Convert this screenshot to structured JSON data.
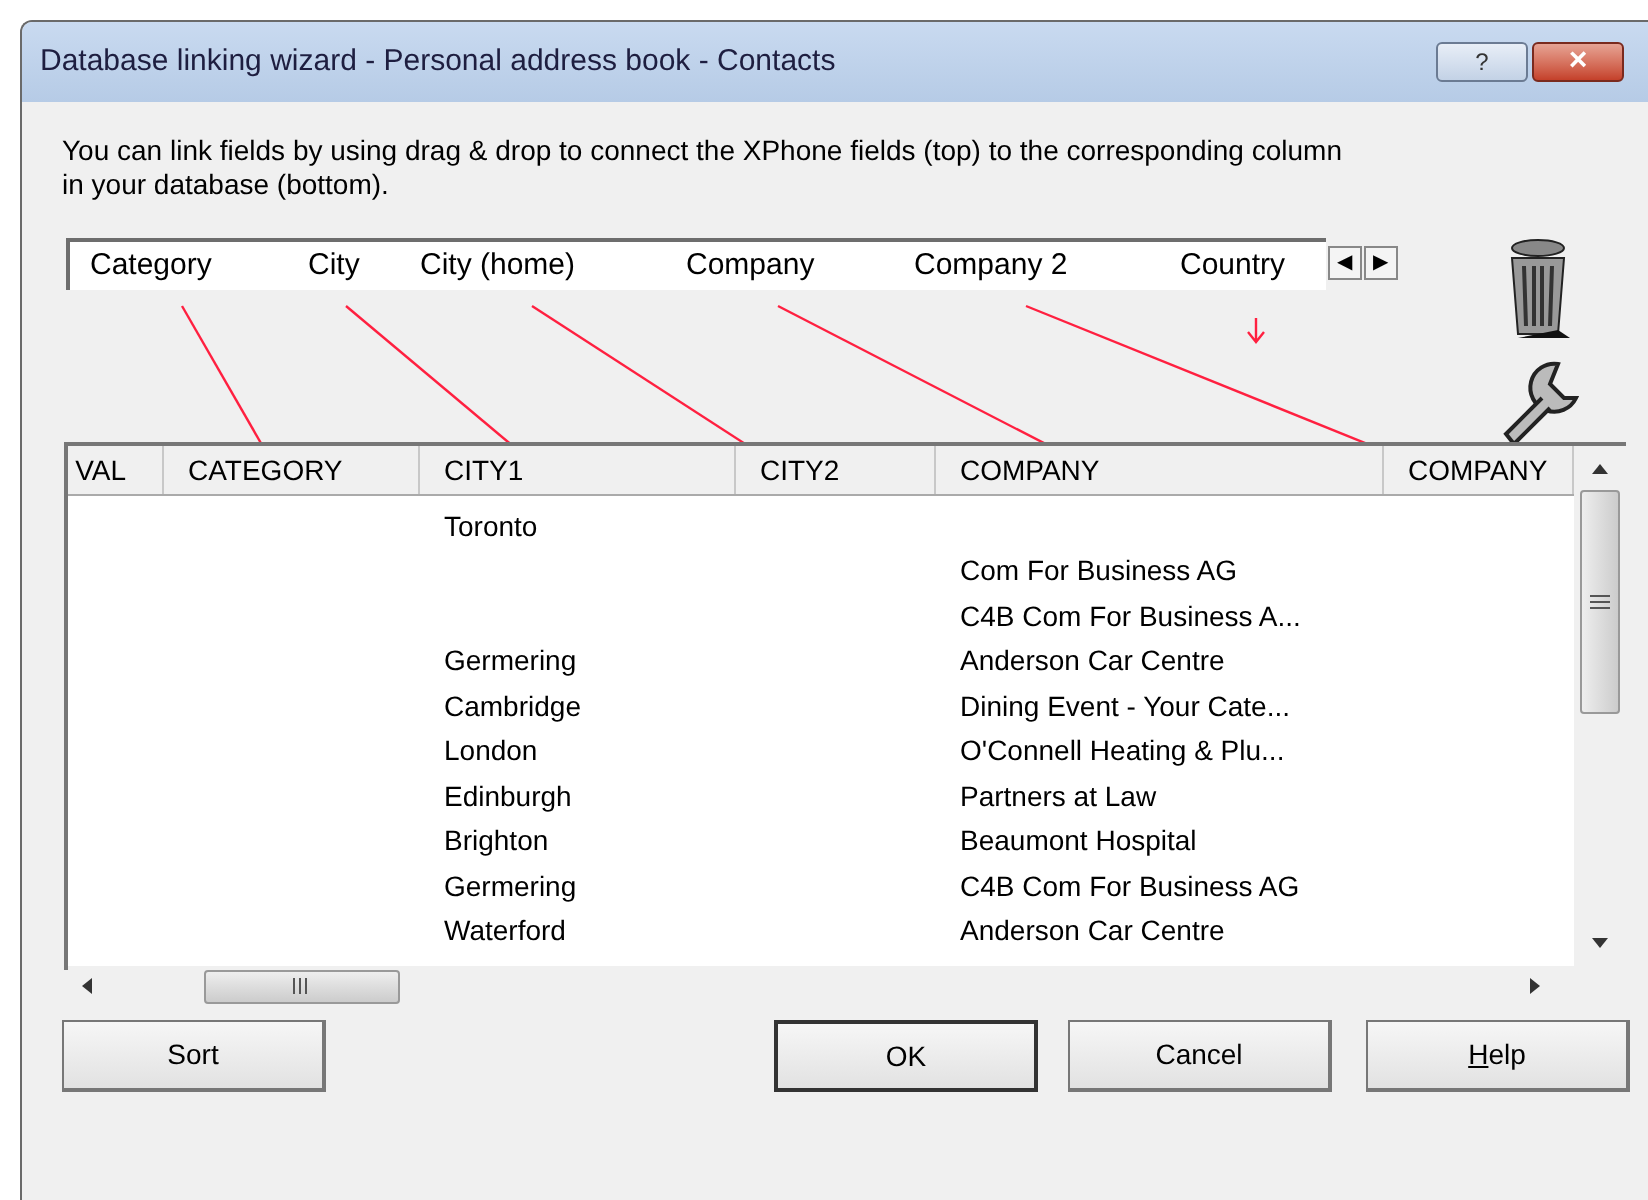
{
  "window": {
    "title": "Database linking wizard - Personal address book - Contacts",
    "help_button": "?",
    "close_button": "×"
  },
  "instructions": "You can link fields by using drag & drop to connect the XPhone fields (top) to the corresponding column in your database (bottom).",
  "fields": [
    {
      "label": "Category",
      "linked": true
    },
    {
      "label": "City",
      "linked": true
    },
    {
      "label": "City (home)",
      "linked": true
    },
    {
      "label": "Company",
      "linked": true
    },
    {
      "label": "Company 2",
      "linked": true
    },
    {
      "label": "Country",
      "linked": false
    }
  ],
  "field_scroll": {
    "left": "◀",
    "right": "▶"
  },
  "table": {
    "columns": [
      "VAL",
      "CATEGORY",
      "CITY1",
      "CITY2",
      "COMPANY",
      "COMPANY"
    ],
    "rows": [
      [
        null,
        null,
        "Toronto",
        null,
        null,
        null
      ],
      [
        null,
        null,
        null,
        null,
        "Com For Business AG",
        null
      ],
      [
        null,
        null,
        null,
        null,
        "C4B Com For Business A...",
        null
      ],
      [
        null,
        null,
        "Germering",
        null,
        "Anderson Car Centre",
        null
      ],
      [
        null,
        null,
        "Cambridge",
        null,
        "Dining Event - Your Cate...",
        null
      ],
      [
        null,
        null,
        "London",
        null,
        "O'Connell Heating & Plu...",
        null
      ],
      [
        null,
        null,
        "Edinburgh",
        null,
        "Partners at Law",
        null
      ],
      [
        null,
        null,
        "Brighton",
        null,
        "Beaumont Hospital",
        null
      ],
      [
        null,
        null,
        "Germering",
        null,
        "C4B Com For Business AG",
        null
      ],
      [
        null,
        null,
        "Waterford",
        null,
        "Anderson Car Centre",
        null
      ]
    ]
  },
  "buttons": [
    {
      "label": "Sort",
      "default": false,
      "underline_first": false
    },
    {
      "label": "OK",
      "default": true,
      "underline_first": false
    },
    {
      "label": "Cancel",
      "default": false,
      "underline_first": false
    },
    {
      "label": "Help",
      "default": false,
      "underline_first": true
    }
  ]
}
